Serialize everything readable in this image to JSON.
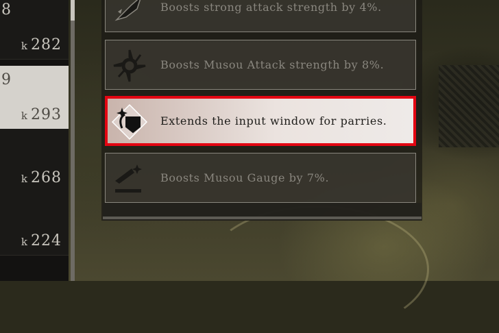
{
  "left_stats": [
    {
      "top": "8",
      "prefix": "k",
      "value": "282"
    },
    {
      "top": "9",
      "prefix": "k",
      "value": "293",
      "selected": true
    },
    {
      "top": "",
      "prefix": "k",
      "value": "268"
    },
    {
      "top": "",
      "prefix": "k",
      "value": "224"
    }
  ],
  "skills": [
    {
      "icon": "strong-attack-icon",
      "text": "Boosts strong attack strength by 4%."
    },
    {
      "icon": "musou-attack-icon",
      "text": "Boosts Musou Attack strength by 8%."
    },
    {
      "icon": "parry-shield-icon",
      "text": "Extends the input window for parries.",
      "selected": true
    },
    {
      "icon": "musou-gauge-icon",
      "text": "Boosts Musou Gauge by 7%."
    }
  ],
  "colors": {
    "highlight": "#e30512"
  }
}
